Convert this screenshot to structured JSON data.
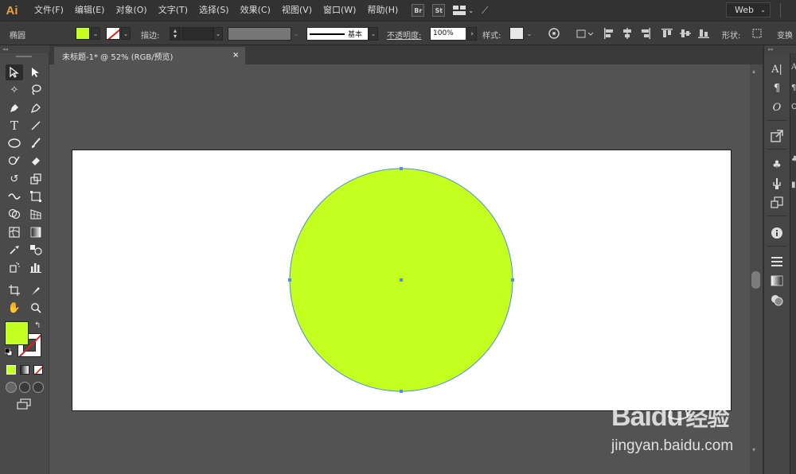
{
  "app": {
    "logo": "Ai",
    "menu": [
      "文件(F)",
      "编辑(E)",
      "对象(O)",
      "文字(T)",
      "选择(S)",
      "效果(C)",
      "视图(V)",
      "窗口(W)",
      "帮助(H)"
    ],
    "bridge_label": "Br",
    "stock_label": "St",
    "workspace": "Web"
  },
  "control_bar": {
    "selection_type": "椭圆",
    "fill_color": "#c3ff1f",
    "stroke_label": "描边:",
    "brush_label": "基本",
    "opacity_label": "不透明度:",
    "opacity_value": "100%",
    "style_label": "样式:",
    "shape_label": "形状:",
    "transform_label": "变换"
  },
  "document": {
    "tab_title": "未标题-1* @ 52% (RGB/预览)",
    "close_glyph": "×"
  },
  "artwork": {
    "shape": "ellipse",
    "fill": "#c3ff1f",
    "selection_color": "#4d8ddb"
  },
  "toolbar": {
    "fill_color": "#c3ff1f",
    "stroke": "none"
  },
  "watermark": {
    "logo_text_1": "Bai",
    "logo_paw": "du",
    "logo_text_2": "经验",
    "url": "jingyan.baidu.com"
  }
}
